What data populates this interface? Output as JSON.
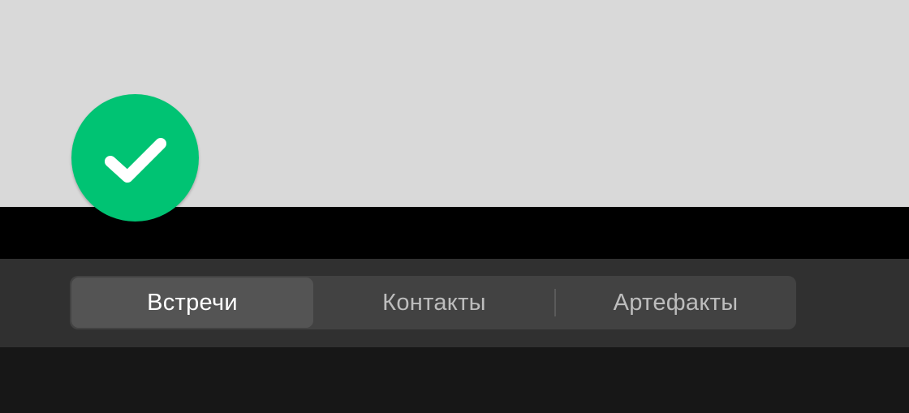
{
  "status": {
    "icon": "checkmark-icon",
    "color": "#00c373"
  },
  "tabs": [
    {
      "label": "Встречи",
      "selected": true
    },
    {
      "label": "Контакты",
      "selected": false
    },
    {
      "label": "Артефакты",
      "selected": false
    }
  ],
  "colors": {
    "tab_selected_bg": "#545454",
    "tab_bar_bg": "#424242",
    "accent_green": "#00c373"
  }
}
